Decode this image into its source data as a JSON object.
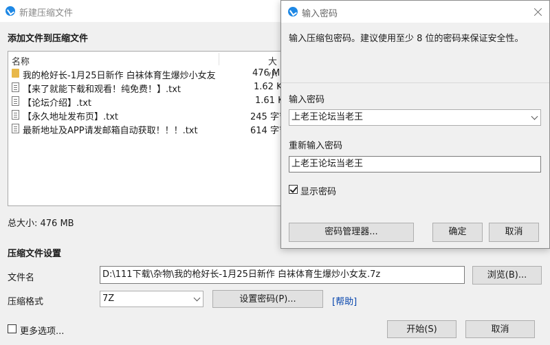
{
  "main": {
    "title": "新建压缩文件",
    "add_section_title": "添加文件到压缩文件",
    "file_list": {
      "col_name": "名称",
      "col_size": "大小",
      "rows": [
        {
          "type": "folder",
          "name": "我的枪好长-1月25日新作 白袜体育生爆炒小女友",
          "size": "476 M"
        },
        {
          "type": "file",
          "name": "【来了就能下载和观看！纯免费！】.txt",
          "size": "1.62 K"
        },
        {
          "type": "file",
          "name": "【论坛介绍】.txt",
          "size": "1.61 K"
        },
        {
          "type": "file",
          "name": "【永久地址发布页】.txt",
          "size": "245 字节"
        },
        {
          "type": "file",
          "name": "最新地址及APP请发邮箱自动获取！！！.txt",
          "size": "614 字节"
        }
      ]
    },
    "total_size": "总大小: 476 MB",
    "settings_title": "压缩文件设置",
    "filename_label": "文件名",
    "filename_value": "D:\\111下载\\杂物\\我的枪好长-1月25日新作 白袜体育生爆炒小女友.7z",
    "browse_button": "浏览(B)...",
    "format_label": "压缩格式",
    "format_value": "7Z",
    "set_password_button": "设置密码(P)...",
    "help_link": "[帮助]",
    "more_options_label": "更多选项...",
    "more_options_checked": false,
    "start_button": "开始(S)",
    "cancel_button": "取消"
  },
  "dialog": {
    "title": "输入密码",
    "description": "输入压缩包密码。建议使用至少 8 位的密码来保证安全性。",
    "password_label": "输入密码",
    "password_value": "上老王论坛当老王",
    "reenter_label": "重新输入密码",
    "reenter_value": "上老王论坛当老王",
    "show_password_label": "显示密码",
    "show_password_checked": true,
    "password_manager_button": "密码管理器...",
    "ok_button": "确定",
    "cancel_button": "取消"
  },
  "colors": {
    "accent": "#1e88e5",
    "link": "#0645ad",
    "window_bg": "#f0f0f0"
  }
}
